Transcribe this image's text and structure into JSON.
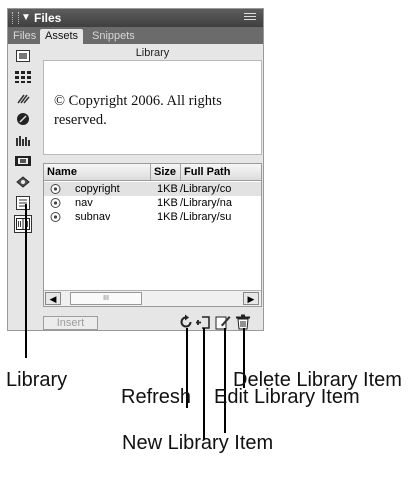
{
  "panel": {
    "title": "Files",
    "tabs": [
      {
        "label": "Files",
        "active": false
      },
      {
        "label": "Assets",
        "active": true
      },
      {
        "label": "Snippets",
        "active": false
      }
    ]
  },
  "asset_categories": [
    {
      "icon": "images-icon"
    },
    {
      "icon": "colors-icon"
    },
    {
      "icon": "urls-icon"
    },
    {
      "icon": "flash-icon"
    },
    {
      "icon": "shockwave-icon"
    },
    {
      "icon": "movies-icon"
    },
    {
      "icon": "scripts-icon"
    },
    {
      "icon": "templates-icon"
    },
    {
      "icon": "library-icon",
      "active": true
    }
  ],
  "preview": {
    "heading": "Library",
    "text": "© Copyright 2006. All rights reserved."
  },
  "table": {
    "columns": [
      "Name",
      "Size",
      "Full Path"
    ],
    "rows": [
      {
        "name": "copyright",
        "size": "1KB",
        "path": "/Library/co",
        "selected": true
      },
      {
        "name": "nav",
        "size": "1KB",
        "path": "/Library/na",
        "selected": false
      },
      {
        "name": "subnav",
        "size": "1KB",
        "path": "/Library/su",
        "selected": false
      }
    ],
    "scroll_thumb": "III"
  },
  "footer": {
    "insert_label": "Insert"
  },
  "callouts": {
    "library": "Library",
    "delete": "Delete Library Item",
    "refresh": "Refresh",
    "edit": "Edit Library Item",
    "new": "New Library Item"
  }
}
